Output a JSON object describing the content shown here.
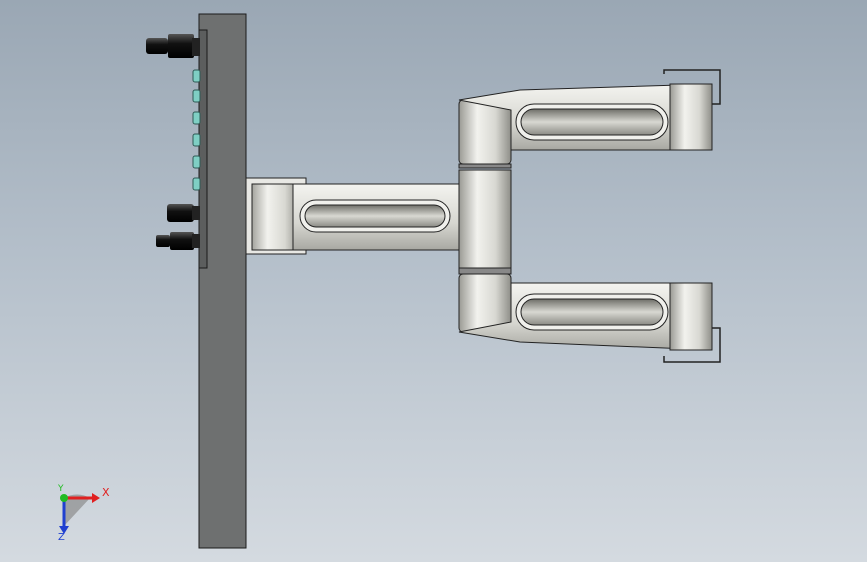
{
  "viewport": {
    "background_top": "#9aa7b4",
    "background_bottom": "#d4dae0"
  },
  "model": {
    "parts": [
      "base-plate",
      "connector-pins",
      "led-indicators",
      "short-bracket-arm",
      "hinge-column",
      "upper-arm",
      "lower-arm",
      "clips"
    ]
  },
  "triad": {
    "x_label": "X",
    "y_label": "Y",
    "z_label": "Z",
    "x_color": "#e02020",
    "y_color": "#22bb22",
    "z_color": "#2040d0"
  }
}
